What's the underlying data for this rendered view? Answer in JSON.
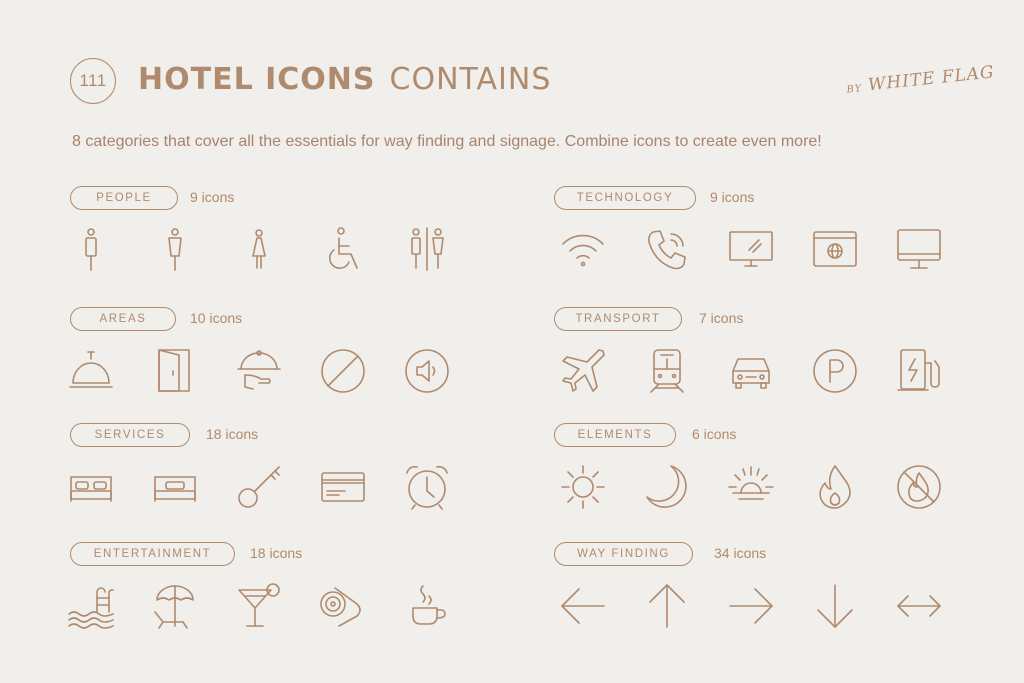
{
  "header": {
    "badge": "111",
    "title_bold": "HOTEL ICONS",
    "title_light": "CONTAINS",
    "by": "BY",
    "author": "WHITE FLAG"
  },
  "subtitle": "8 categories that cover all the essentials for way finding and signage. Combine icons to create even more!",
  "categories": [
    {
      "label": "PEOPLE",
      "count": "9 icons",
      "icons": [
        "man-icon",
        "woman-icon",
        "girl-icon",
        "wheelchair-icon",
        "toilet-icon"
      ]
    },
    {
      "label": "TECHNOLOGY",
      "count": "9 icons",
      "icons": [
        "wifi-icon",
        "phone-icon",
        "tv-icon",
        "web-browser-icon",
        "monitor-icon"
      ]
    },
    {
      "label": "AREAS",
      "count": "10 icons",
      "icons": [
        "reception-bell-icon",
        "door-icon",
        "room-service-icon",
        "prohibited-icon",
        "speaker-icon"
      ]
    },
    {
      "label": "TRANSPORT",
      "count": "7 icons",
      "icons": [
        "airplane-icon",
        "train-icon",
        "car-icon",
        "parking-icon",
        "charging-station-icon"
      ]
    },
    {
      "label": "SERVICES",
      "count": "18 icons",
      "icons": [
        "double-bed-icon",
        "single-bed-icon",
        "key-icon",
        "credit-card-icon",
        "alarm-clock-icon"
      ]
    },
    {
      "label": "ELEMENTS",
      "count": "6 icons",
      "icons": [
        "sun-icon",
        "moon-icon",
        "sunset-icon",
        "fire-icon",
        "no-fire-icon"
      ]
    },
    {
      "label": "ENTERTAINMENT",
      "count": "18 icons",
      "icons": [
        "pool-icon",
        "beach-umbrella-icon",
        "cocktail-icon",
        "towel-icon",
        "coffee-cup-icon"
      ]
    },
    {
      "label": "WAY FINDING",
      "count": "34 icons",
      "icons": [
        "arrow-left-icon",
        "arrow-up-icon",
        "arrow-right-icon",
        "arrow-down-icon",
        "arrow-left-right-icon"
      ]
    }
  ]
}
